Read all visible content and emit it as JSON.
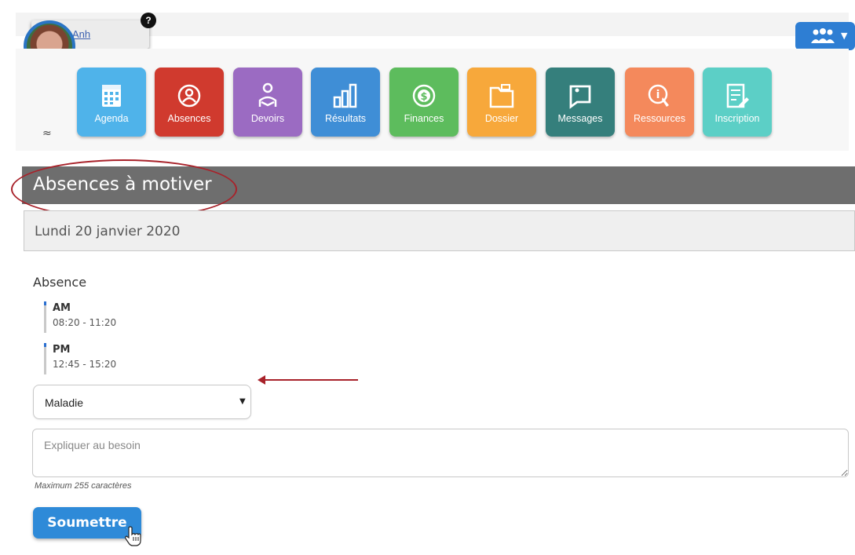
{
  "user": {
    "name": "Anh",
    "help_icon": "question-icon",
    "help_glyph": "?"
  },
  "nav": {
    "collapse_icon": "chevrons-up-icon",
    "collapse_glyph": "≈",
    "tiles": [
      {
        "label": "Agenda",
        "icon": "calendar-icon",
        "color": "#4fb3ea"
      },
      {
        "label": "Absences",
        "icon": "absence-person-icon",
        "color": "#d03a2e"
      },
      {
        "label": "Devoirs",
        "icon": "homework-person-icon",
        "color": "#9b6bc2"
      },
      {
        "label": "Résultats",
        "icon": "bar-chart-icon",
        "color": "#3f8ed6"
      },
      {
        "label": "Finances",
        "icon": "dollar-coin-icon",
        "color": "#5dbc5d"
      },
      {
        "label": "Dossier",
        "icon": "folder-icon",
        "color": "#f7a83b"
      },
      {
        "label": "Messages",
        "icon": "message-icon",
        "color": "#357f7c"
      },
      {
        "label": "Ressources",
        "icon": "resources-icon",
        "color": "#f4895c"
      },
      {
        "label": "Inscription",
        "icon": "form-icon",
        "color": "#5ccfc6"
      }
    ]
  },
  "group_menu": {
    "icon": "users-group-icon",
    "caret": "▼",
    "color": "#2e7ed3"
  },
  "section": {
    "title": "Absences à motiver",
    "date": "Lundi 20 janvier 2020"
  },
  "absence": {
    "label": "Absence",
    "periods": [
      {
        "name": "AM",
        "time": "08:20 - 11:20"
      },
      {
        "name": "PM",
        "time": "12:45 - 15:20"
      }
    ],
    "reason_value": "Maladie",
    "reason_caret": "▼",
    "explain_placeholder": "Expliquer au besoin",
    "explain_hint": "Maximum 255 caractères",
    "submit_label": "Soumettre"
  },
  "annotation_color": "#a8222a"
}
